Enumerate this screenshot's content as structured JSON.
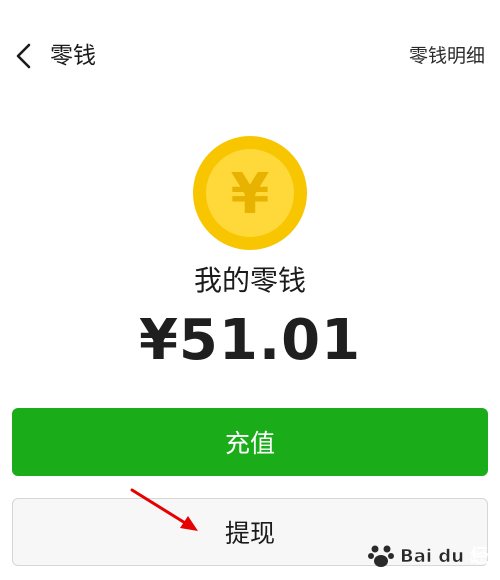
{
  "header": {
    "title": "零钱",
    "detail_link": "零钱明细",
    "back_icon": "chevron-left-icon"
  },
  "coin": {
    "icon": "yuan-coin-icon",
    "symbol": "¥",
    "colors": {
      "outer": "#f7c600",
      "inner": "#ffd83a",
      "symbol": "#e8b200"
    }
  },
  "balance": {
    "label": "我的零钱",
    "amount": "¥51.01"
  },
  "buttons": {
    "recharge": "充值",
    "withdraw": "提现"
  },
  "colors": {
    "accent_green": "#1aad19",
    "annotation_red": "#e60000"
  },
  "watermark": {
    "text": "Bai du 经验"
  }
}
